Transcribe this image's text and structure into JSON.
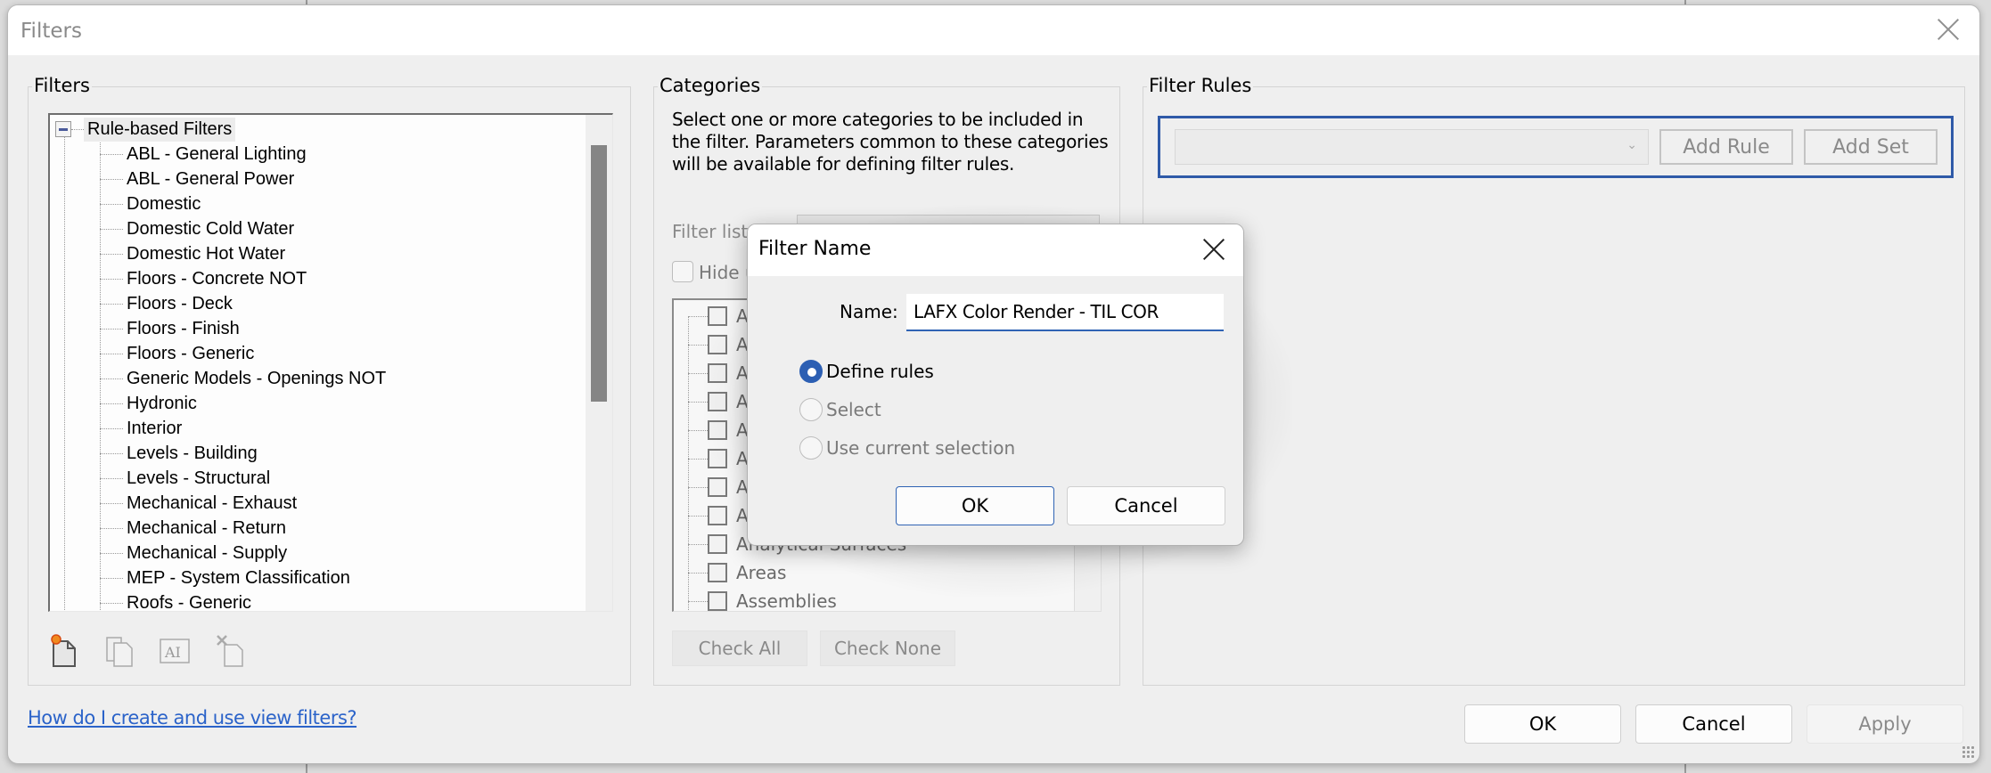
{
  "window": {
    "title": "Filters",
    "close_icon": "close-x-icon"
  },
  "filters_panel": {
    "label": "Filters",
    "root": {
      "label": "Rule-based Filters",
      "expanded": true,
      "items": [
        "ABL - General Lighting",
        "ABL - General Power",
        "Domestic",
        "Domestic Cold Water",
        "Domestic Hot Water",
        "Floors - Concrete NOT",
        "Floors - Deck",
        "Floors - Finish",
        "Floors - Generic",
        "Generic Models - Openings NOT",
        "Hydronic",
        "Interior",
        "Levels - Building",
        "Levels - Structural",
        "Mechanical - Exhaust",
        "Mechanical - Return",
        "Mechanical - Supply",
        "MEP - System Classification",
        "Roofs - Generic"
      ]
    },
    "toolbar": [
      {
        "name": "new-filter",
        "icon": "new-document-icon",
        "enabled": true
      },
      {
        "name": "duplicate-filter",
        "icon": "duplicate-icon",
        "enabled": false
      },
      {
        "name": "rename-filter",
        "icon": "rename-icon",
        "enabled": false
      },
      {
        "name": "delete-filter",
        "icon": "delete-icon",
        "enabled": false
      }
    ]
  },
  "categories_panel": {
    "label": "Categories",
    "description": "Select one or more categories to be included in the filter.  Parameters common to these categories will be available for defining filter rules.",
    "filter_list_label": "Filter list:",
    "hide_label": "Hide u",
    "items": [
      {
        "label": "A",
        "checked": false
      },
      {
        "label": "A",
        "checked": false
      },
      {
        "label": "A",
        "checked": false
      },
      {
        "label": "A",
        "checked": false
      },
      {
        "label": "A",
        "checked": false
      },
      {
        "label": "A",
        "checked": false
      },
      {
        "label": "A",
        "checked": false
      },
      {
        "label": "A",
        "checked": false
      },
      {
        "label": "Analytical Surfaces",
        "checked": false
      },
      {
        "label": "Areas",
        "checked": false
      },
      {
        "label": "Assemblies",
        "checked": false
      }
    ],
    "check_all": "Check All",
    "check_none": "Check None"
  },
  "rules_panel": {
    "label": "Filter Rules",
    "select_value": "",
    "add_rule": "Add Rule",
    "add_set": "Add Set"
  },
  "footer": {
    "help_link": "How do I create and use view filters?",
    "ok": "OK",
    "cancel": "Cancel",
    "apply": "Apply"
  },
  "filter_name_dialog": {
    "title": "Filter Name",
    "name_label": "Name:",
    "name_value": "LAFX Color Render - TIL COR",
    "options": [
      {
        "label": "Define rules",
        "selected": true,
        "enabled": true
      },
      {
        "label": "Select",
        "selected": false,
        "enabled": false
      },
      {
        "label": "Use current selection",
        "selected": false,
        "enabled": false
      }
    ],
    "ok": "OK",
    "cancel": "Cancel"
  },
  "colors": {
    "accent": "#2f5aa8",
    "link": "#2b63c9",
    "radio_selected": "#2c5fb3"
  }
}
